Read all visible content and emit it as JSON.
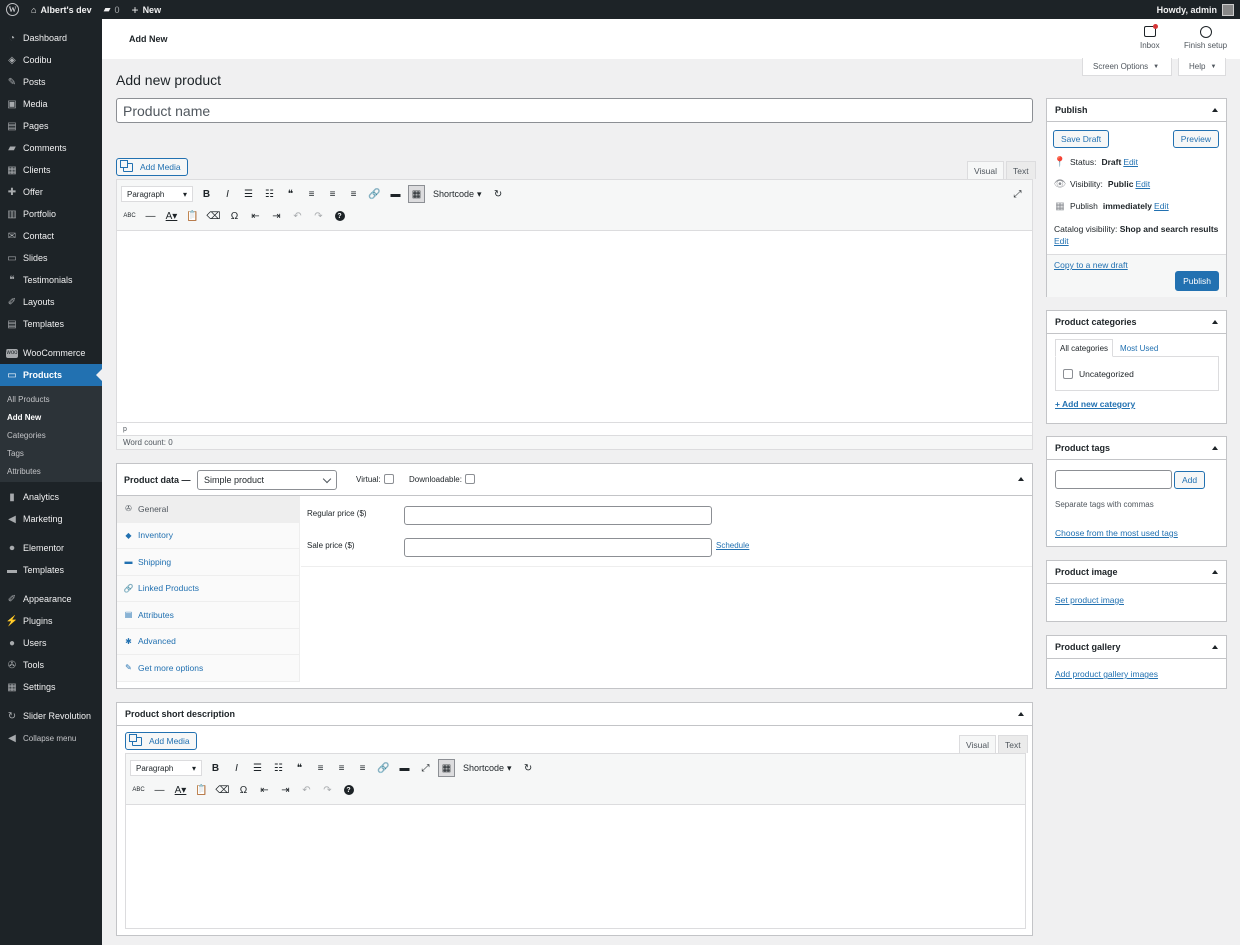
{
  "adminbar": {
    "site_name": "Albert's dev",
    "comments_count": "0",
    "new_label": "New",
    "howdy": "Howdy, admin"
  },
  "sidebar": {
    "items_top": [
      {
        "label": "Dashboard",
        "icon": "dashboard-icon"
      },
      {
        "label": "Codibu",
        "icon": "codibu-icon"
      },
      {
        "label": "Posts",
        "icon": "pin-icon"
      },
      {
        "label": "Media",
        "icon": "media-icon"
      },
      {
        "label": "Pages",
        "icon": "pages-icon"
      },
      {
        "label": "Comments",
        "icon": "comment-icon"
      },
      {
        "label": "Clients",
        "icon": "clients-icon"
      },
      {
        "label": "Offer",
        "icon": "offer-icon"
      },
      {
        "label": "Portfolio",
        "icon": "portfolio-icon"
      },
      {
        "label": "Contact",
        "icon": "mail-icon"
      },
      {
        "label": "Slides",
        "icon": "slides-icon"
      },
      {
        "label": "Testimonials",
        "icon": "quote-icon"
      },
      {
        "label": "Layouts",
        "icon": "brush-icon"
      },
      {
        "label": "Templates",
        "icon": "templates-icon"
      }
    ],
    "woocommerce": "WooCommerce",
    "products": "Products",
    "submenu": [
      "All Products",
      "Add New",
      "Categories",
      "Tags",
      "Attributes"
    ],
    "items_bottom1": [
      {
        "label": "Analytics",
        "icon": "chart-icon"
      },
      {
        "label": "Marketing",
        "icon": "megaphone-icon"
      }
    ],
    "items_bottom2": [
      {
        "label": "Elementor",
        "icon": "elementor-icon"
      },
      {
        "label": "Templates",
        "icon": "folder-icon"
      }
    ],
    "items_bottom3": [
      {
        "label": "Appearance",
        "icon": "brush-icon"
      },
      {
        "label": "Plugins",
        "icon": "plugin-icon"
      },
      {
        "label": "Users",
        "icon": "user-icon"
      },
      {
        "label": "Tools",
        "icon": "wrench-icon"
      },
      {
        "label": "Settings",
        "icon": "settings-icon"
      }
    ],
    "items_bottom4": [
      {
        "label": "Slider Revolution",
        "icon": "refresh-icon"
      },
      {
        "label": "Collapse menu",
        "icon": "collapse-icon"
      }
    ]
  },
  "topbar": {
    "title": "Add New",
    "inbox": "Inbox",
    "finish_setup": "Finish setup"
  },
  "screen_options": "Screen Options",
  "help": "Help",
  "page_title": "Add new product",
  "product_name_placeholder": "Product name",
  "editor": {
    "add_media": "Add Media",
    "visual": "Visual",
    "text": "Text",
    "format": "Paragraph",
    "shortcode": "Shortcode",
    "path": "p",
    "word_count": "Word count: 0"
  },
  "product_data": {
    "label": "Product data —",
    "type": "Simple product",
    "virtual": "Virtual:",
    "downloadable": "Downloadable:",
    "tabs": [
      {
        "label": "General",
        "icon": "wrench-icon"
      },
      {
        "label": "Inventory",
        "icon": "tag-icon"
      },
      {
        "label": "Shipping",
        "icon": "truck-icon"
      },
      {
        "label": "Linked Products",
        "icon": "link-icon"
      },
      {
        "label": "Attributes",
        "icon": "list-icon"
      },
      {
        "label": "Advanced",
        "icon": "gear-icon"
      },
      {
        "label": "Get more options",
        "icon": "plugin-icon"
      }
    ],
    "regular_price": "Regular price ($)",
    "sale_price": "Sale price ($)",
    "schedule": "Schedule"
  },
  "short_desc": {
    "title": "Product short description"
  },
  "publish": {
    "title": "Publish",
    "save_draft": "Save Draft",
    "preview": "Preview",
    "status_label": "Status:",
    "status_value": "Draft",
    "visibility_label": "Visibility:",
    "visibility_value": "Public",
    "publish_label": "Publish",
    "publish_value": "immediately",
    "edit": "Edit",
    "catalog_label": "Catalog visibility:",
    "catalog_value": "Shop and search results",
    "copy_draft": "Copy to a new draft",
    "publish_button": "Publish"
  },
  "categories": {
    "title": "Product categories",
    "tab_all": "All categories",
    "tab_most": "Most Used",
    "item": "Uncategorized",
    "add_new": "+ Add new category"
  },
  "tags": {
    "title": "Product tags",
    "add": "Add",
    "hint": "Separate tags with commas",
    "choose": "Choose from the most used tags"
  },
  "image": {
    "title": "Product image",
    "link": "Set product image"
  },
  "gallery": {
    "title": "Product gallery",
    "link": "Add product gallery images"
  }
}
